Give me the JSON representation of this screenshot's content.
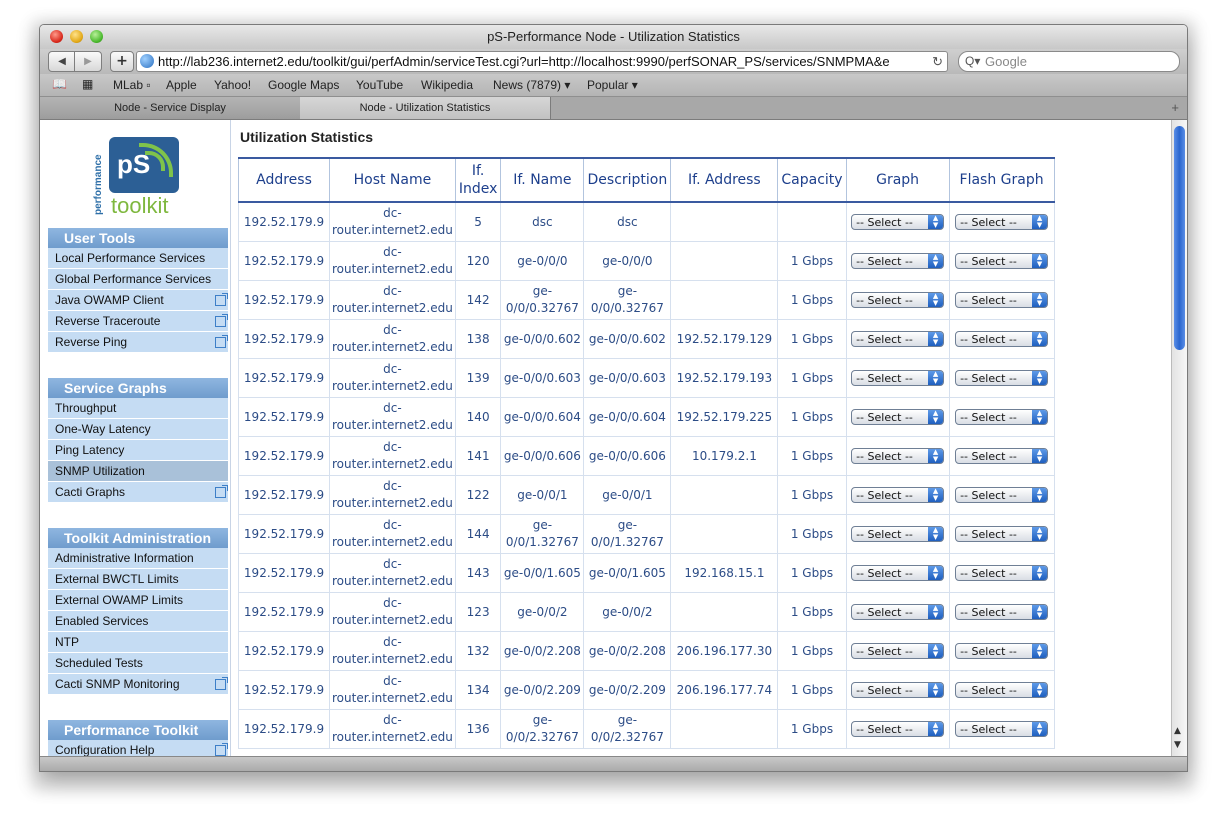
{
  "window": {
    "title": "pS-Performance Node - Utilization Statistics"
  },
  "toolbar": {
    "back_icon": "◀",
    "forward_icon": "▶",
    "add_icon": "+",
    "url": "http://lab236.internet2.edu/toolkit/gui/perfAdmin/serviceTest.cgi?url=http://localhost:9990/perfSONAR_PS/services/SNMPMA&e",
    "reload_icon": "↻",
    "search_placeholder": "Google",
    "search_icon": "Q▾"
  },
  "bookmarks": {
    "book_icon": "📖",
    "grid_icon": "▦",
    "items": [
      "MLab ▫",
      "Apple",
      "Yahoo!",
      "Google Maps",
      "YouTube",
      "Wikipedia",
      "News (7879) ▾",
      "Popular ▾"
    ]
  },
  "tabs": [
    {
      "label": "Node - Service Display"
    },
    {
      "label": "Node - Utilization Statistics"
    }
  ],
  "tabs_plus": "+",
  "logo": {
    "vertical": "performance",
    "ps": "pS",
    "toolkit": "toolkit"
  },
  "sidebar": {
    "user_tools": {
      "header": "User Tools",
      "items": [
        "Local Performance Services",
        "Global Performance Services",
        "Java OWAMP Client",
        "Reverse Traceroute",
        "Reverse Ping"
      ]
    },
    "service_graphs": {
      "header": "Service Graphs",
      "items": [
        "Throughput",
        "One-Way Latency",
        "Ping Latency",
        "SNMP Utilization",
        "Cacti Graphs"
      ]
    },
    "toolkit_admin": {
      "header": "Toolkit Administration",
      "items": [
        "Administrative Information",
        "External BWCTL Limits",
        "External OWAMP Limits",
        "Enabled Services",
        "NTP",
        "Scheduled Tests",
        "Cacti SNMP Monitoring"
      ]
    },
    "performance_toolkit": {
      "header": "Performance Toolkit",
      "items": [
        "Configuration Help"
      ]
    }
  },
  "main": {
    "title": "Utilization Statistics",
    "columns": [
      "Address",
      "Host Name",
      "If. Index",
      "If. Name",
      "Description",
      "If. Address",
      "Capacity",
      "Graph",
      "Flash Graph"
    ],
    "select_label": "-- Select --",
    "rows": [
      {
        "address": "192.52.179.9",
        "host": "dc-router.internet2.edu",
        "index": "5",
        "name": "dsc",
        "desc": "dsc",
        "ifaddr": "",
        "capacity": ""
      },
      {
        "address": "192.52.179.9",
        "host": "dc-router.internet2.edu",
        "index": "120",
        "name": "ge-0/0/0",
        "desc": "ge-0/0/0",
        "ifaddr": "",
        "capacity": "1 Gbps"
      },
      {
        "address": "192.52.179.9",
        "host": "dc-router.internet2.edu",
        "index": "142",
        "name": "ge-0/0/0.32767",
        "desc": "ge-0/0/0.32767",
        "ifaddr": "",
        "capacity": "1 Gbps"
      },
      {
        "address": "192.52.179.9",
        "host": "dc-router.internet2.edu",
        "index": "138",
        "name": "ge-0/0/0.602",
        "desc": "ge-0/0/0.602",
        "ifaddr": "192.52.179.129",
        "capacity": "1 Gbps"
      },
      {
        "address": "192.52.179.9",
        "host": "dc-router.internet2.edu",
        "index": "139",
        "name": "ge-0/0/0.603",
        "desc": "ge-0/0/0.603",
        "ifaddr": "192.52.179.193",
        "capacity": "1 Gbps"
      },
      {
        "address": "192.52.179.9",
        "host": "dc-router.internet2.edu",
        "index": "140",
        "name": "ge-0/0/0.604",
        "desc": "ge-0/0/0.604",
        "ifaddr": "192.52.179.225",
        "capacity": "1 Gbps"
      },
      {
        "address": "192.52.179.9",
        "host": "dc-router.internet2.edu",
        "index": "141",
        "name": "ge-0/0/0.606",
        "desc": "ge-0/0/0.606",
        "ifaddr": "10.179.2.1",
        "capacity": "1 Gbps"
      },
      {
        "address": "192.52.179.9",
        "host": "dc-router.internet2.edu",
        "index": "122",
        "name": "ge-0/0/1",
        "desc": "ge-0/0/1",
        "ifaddr": "",
        "capacity": "1 Gbps"
      },
      {
        "address": "192.52.179.9",
        "host": "dc-router.internet2.edu",
        "index": "144",
        "name": "ge-0/0/1.32767",
        "desc": "ge-0/0/1.32767",
        "ifaddr": "",
        "capacity": "1 Gbps"
      },
      {
        "address": "192.52.179.9",
        "host": "dc-router.internet2.edu",
        "index": "143",
        "name": "ge-0/0/1.605",
        "desc": "ge-0/0/1.605",
        "ifaddr": "192.168.15.1",
        "capacity": "1 Gbps"
      },
      {
        "address": "192.52.179.9",
        "host": "dc-router.internet2.edu",
        "index": "123",
        "name": "ge-0/0/2",
        "desc": "ge-0/0/2",
        "ifaddr": "",
        "capacity": "1 Gbps"
      },
      {
        "address": "192.52.179.9",
        "host": "dc-router.internet2.edu",
        "index": "132",
        "name": "ge-0/0/2.208",
        "desc": "ge-0/0/2.208",
        "ifaddr": "206.196.177.30",
        "capacity": "1 Gbps"
      },
      {
        "address": "192.52.179.9",
        "host": "dc-router.internet2.edu",
        "index": "134",
        "name": "ge-0/0/2.209",
        "desc": "ge-0/0/2.209",
        "ifaddr": "206.196.177.74",
        "capacity": "1 Gbps"
      },
      {
        "address": "192.52.179.9",
        "host": "dc-router.internet2.edu",
        "index": "136",
        "name": "ge-0/0/2.32767",
        "desc": "ge-0/0/2.32767",
        "ifaddr": "",
        "capacity": "1 Gbps"
      }
    ]
  },
  "colors": {
    "accent": "#6f9ccd",
    "link": "#2c4c86",
    "menu_bg": "#c5dcf3"
  }
}
